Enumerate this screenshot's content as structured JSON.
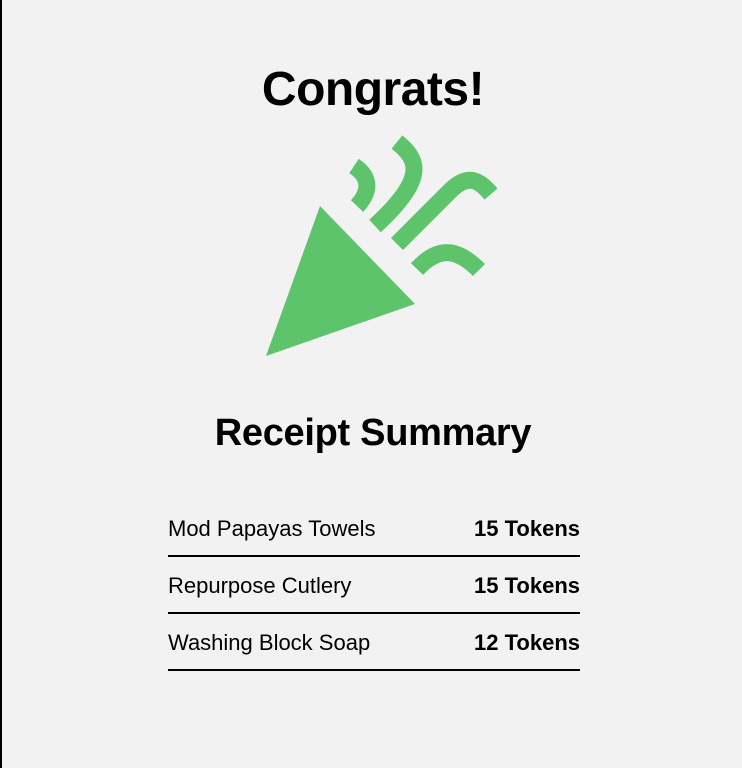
{
  "header": {
    "title": "Congrats!"
  },
  "icon": {
    "name": "party-popper-icon",
    "color": "#5ec46c"
  },
  "summary": {
    "title": "Receipt Summary",
    "items": [
      {
        "name": "Mod Papayas Towels",
        "cost": "15 Tokens"
      },
      {
        "name": "Repurpose Cutlery",
        "cost": "15 Tokens"
      },
      {
        "name": "Washing Block Soap",
        "cost": "12 Tokens"
      }
    ]
  }
}
